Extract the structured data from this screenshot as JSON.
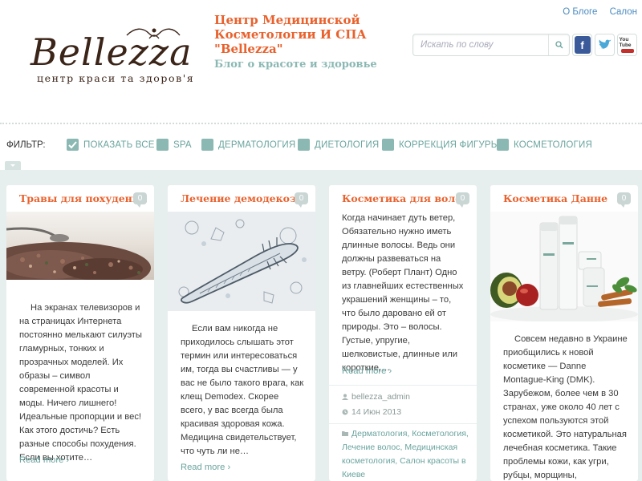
{
  "header": {
    "logo_text": "Bellezza",
    "logo_sub": "центр краси та здоров'я",
    "site_title": "Центр Медицинской Косметологии И СПА \"Bellezza\"",
    "site_tagline": "Блог о красоте и здоровье",
    "top_links": [
      "О Блоге",
      "Салон"
    ],
    "search_placeholder": "Искать по слову",
    "social": [
      "f",
      "t",
      "You Tube"
    ]
  },
  "filter": {
    "label": "ФИЛЬТР:",
    "items": [
      "ПОКАЗАТЬ ВСЕ",
      "SPA",
      "ДЕРМАТОЛОГИЯ",
      "ДИЕТОЛОГИЯ",
      "КОРРЕКЦИЯ ФИГУРЫ",
      "КОСМЕТОЛОГИЯ"
    ]
  },
  "posts": [
    {
      "title": "Травы для похудения",
      "comments": "0",
      "excerpt": "На экранах телевизоров и на страницах Интернета постоянно мелькают силуэты гламурных, тонких и прозрачных моделей. Их образы – символ современной красоты и моды. Ничего лишнего! Идеальные пропорции и вес! Как этого достичь? Есть разные способы похудения. Если вы хотите…",
      "read_more": "Read more ›"
    },
    {
      "title": "Лечение демодекоза",
      "comments": "0",
      "excerpt": "Если вам никогда не приходилось слышать этот термин или интересоваться им, тогда вы счастливы — у вас не было такого врага, как клещ Demodex. Скорее всего, у вас всегда была красивая здоровая кожа. Медицина свидетельствует, что чуть ли не…",
      "read_more": "Read more ›"
    },
    {
      "title": "Косметика для волос",
      "comments": "0",
      "excerpt": "Когда начинает дуть ветер, Обязательно нужно иметь длинные волосы. Ведь они должны развеваться на ветру. (Роберт Плант) Одно из главнейших естественных украшений женщины – то, что было даровано ей от природы. Это – волосы. Густые, упругие, шелковистые, длинные или короткие,…",
      "read_more": "Read more ›",
      "author": "bellezza_admin",
      "date": "14 Июн 2013",
      "tags": "Дерматология, Косметология, Лечение волос, Медицинская косметология, Салон красоты в Киеве"
    },
    {
      "title": "Косметика Данне",
      "comments": "0",
      "excerpt": "Совсем недавно в Украине приобщились к новой косметике — Danne Montague-King (DMK). Зарубежом, более чем в 30 странах, уже около 40 лет с успехом пользуются этой косметикой. Это натуральная лечебная косметика. Такие проблемы кожи, как угри, рубцы, морщины, пигментация…"
    }
  ],
  "colors": {
    "accent": "#e8622e",
    "teal": "#8bb8b3",
    "link": "#6aa49e",
    "content_bg": "#e6efed"
  }
}
